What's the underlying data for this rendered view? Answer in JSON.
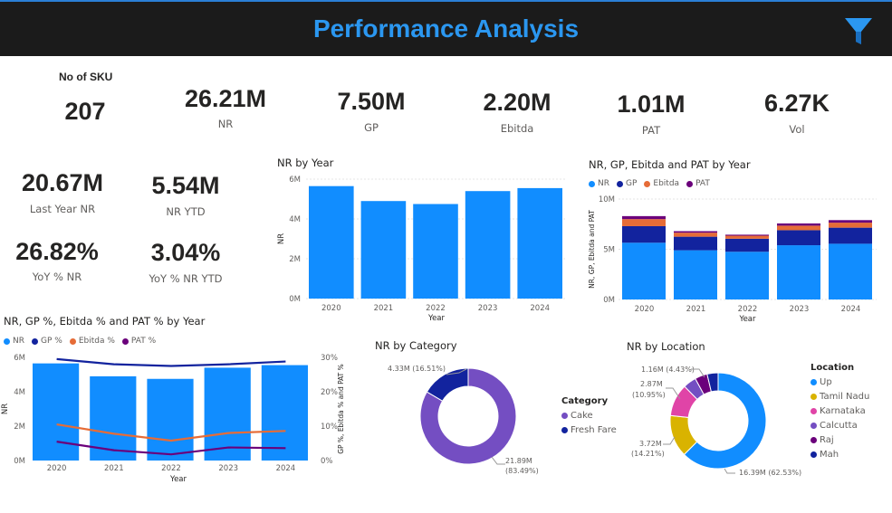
{
  "header": {
    "title": "Performance Analysis",
    "filter_icon": "filter-icon"
  },
  "colors": {
    "nr": "#118dff",
    "gp": "#12239e",
    "ebitda": "#e66c37",
    "pat": "#6b007b",
    "cake": "#744ec2",
    "fresh_fare": "#12239e",
    "up": "#118dff",
    "tamil_nadu": "#d9b300",
    "karnataka": "#e044a7",
    "calcutta": "#744ec2",
    "raj": "#6b007b",
    "mah": "#12239e"
  },
  "kpis": {
    "sku": {
      "label": "No of SKU",
      "value": "207"
    },
    "nr": {
      "value": "26.21M",
      "label": "NR"
    },
    "gp": {
      "value": "7.50M",
      "label": "GP"
    },
    "ebitda": {
      "value": "2.20M",
      "label": "Ebitda"
    },
    "pat": {
      "value": "1.01M",
      "label": "PAT"
    },
    "vol": {
      "value": "6.27K",
      "label": "Vol"
    },
    "last_year_nr": {
      "value": "20.67M",
      "label": "Last Year NR"
    },
    "nr_ytd": {
      "value": "5.54M",
      "label": "NR YTD"
    },
    "yoy_nr": {
      "value": "26.82%",
      "label": "YoY % NR"
    },
    "yoy_nr_ytd": {
      "value": "3.04%",
      "label": "YoY % NR YTD"
    }
  },
  "chart_data": [
    {
      "id": "nr_by_year",
      "type": "bar",
      "title": "NR by Year",
      "xlabel": "Year",
      "ylabel": "NR",
      "categories": [
        "2020",
        "2021",
        "2022",
        "2023",
        "2024"
      ],
      "series": [
        {
          "name": "NR",
          "values": [
            5.65,
            4.9,
            4.75,
            5.4,
            5.55
          ]
        }
      ],
      "y_ticks": [
        "0M",
        "2M",
        "4M",
        "6M"
      ],
      "ylim": [
        0,
        6
      ],
      "grid": true
    },
    {
      "id": "nr_gp_ebitda_pat_by_year",
      "type": "bar",
      "stacked": true,
      "title": "NR, GP, Ebitda and PAT by Year",
      "xlabel": "Year",
      "ylabel": "NR, GP, Ebitda and PAT",
      "categories": [
        "2020",
        "2021",
        "2022",
        "2023",
        "2024"
      ],
      "series": [
        {
          "name": "NR",
          "values": [
            5.65,
            4.9,
            4.75,
            5.4,
            5.55
          ]
        },
        {
          "name": "GP",
          "values": [
            1.65,
            1.35,
            1.3,
            1.5,
            1.6
          ]
        },
        {
          "name": "Ebitda",
          "values": [
            0.7,
            0.4,
            0.3,
            0.45,
            0.5
          ]
        },
        {
          "name": "PAT",
          "values": [
            0.3,
            0.15,
            0.1,
            0.22,
            0.25
          ]
        }
      ],
      "y_ticks": [
        "0M",
        "5M",
        "10M"
      ],
      "ylim": [
        0,
        10
      ],
      "legend": "top-left",
      "grid": true
    },
    {
      "id": "nr_gp_pct_by_year",
      "type": "bar",
      "combo": true,
      "title": "NR, GP %, Ebitda % and PAT % by Year",
      "xlabel": "Year",
      "ylabel": "NR",
      "y2label": "GP %, Ebitda % and PAT %",
      "categories": [
        "2020",
        "2021",
        "2022",
        "2023",
        "2024"
      ],
      "bars": {
        "name": "NR",
        "values": [
          5.65,
          4.9,
          4.75,
          5.4,
          5.55
        ]
      },
      "lines": [
        {
          "name": "GP %",
          "values": [
            29.5,
            28.0,
            27.5,
            28.0,
            28.8
          ]
        },
        {
          "name": "Ebitda %",
          "values": [
            10.5,
            7.8,
            5.8,
            8.0,
            8.6
          ]
        },
        {
          "name": "PAT %",
          "values": [
            5.5,
            3.0,
            1.8,
            3.8,
            3.6
          ]
        }
      ],
      "y_ticks": [
        "0M",
        "2M",
        "4M",
        "6M"
      ],
      "y2_ticks": [
        "0%",
        "10%",
        "20%",
        "30%"
      ],
      "ylim": [
        0,
        6
      ],
      "y2lim": [
        0,
        30
      ],
      "legend": "top-left"
    },
    {
      "id": "nr_by_category",
      "type": "pie",
      "donut": true,
      "title": "NR by Category",
      "legend_title": "Category",
      "slices": [
        {
          "name": "Cake",
          "value": 21.89,
          "label": "21.89M",
          "pct": "(83.49%)"
        },
        {
          "name": "Fresh Fare",
          "value": 4.33,
          "label": "4.33M (16.51%)"
        }
      ]
    },
    {
      "id": "nr_by_location",
      "type": "pie",
      "donut": true,
      "title": "NR by Location",
      "legend_title": "Location",
      "slices": [
        {
          "name": "Up",
          "value": 16.39,
          "label": "16.39M (62.53%)"
        },
        {
          "name": "Tamil Nadu",
          "value": 3.72,
          "label": "3.72M",
          "pct": "(14.21%)"
        },
        {
          "name": "Karnataka",
          "value": 2.87,
          "label": "2.87M",
          "pct": "(10.95%)"
        },
        {
          "name": "Calcutta",
          "value": 1.16,
          "label": "1.16M (4.43%)"
        },
        {
          "name": "Raj",
          "value": 1.1
        },
        {
          "name": "Mah",
          "value": 0.97
        }
      ]
    }
  ]
}
